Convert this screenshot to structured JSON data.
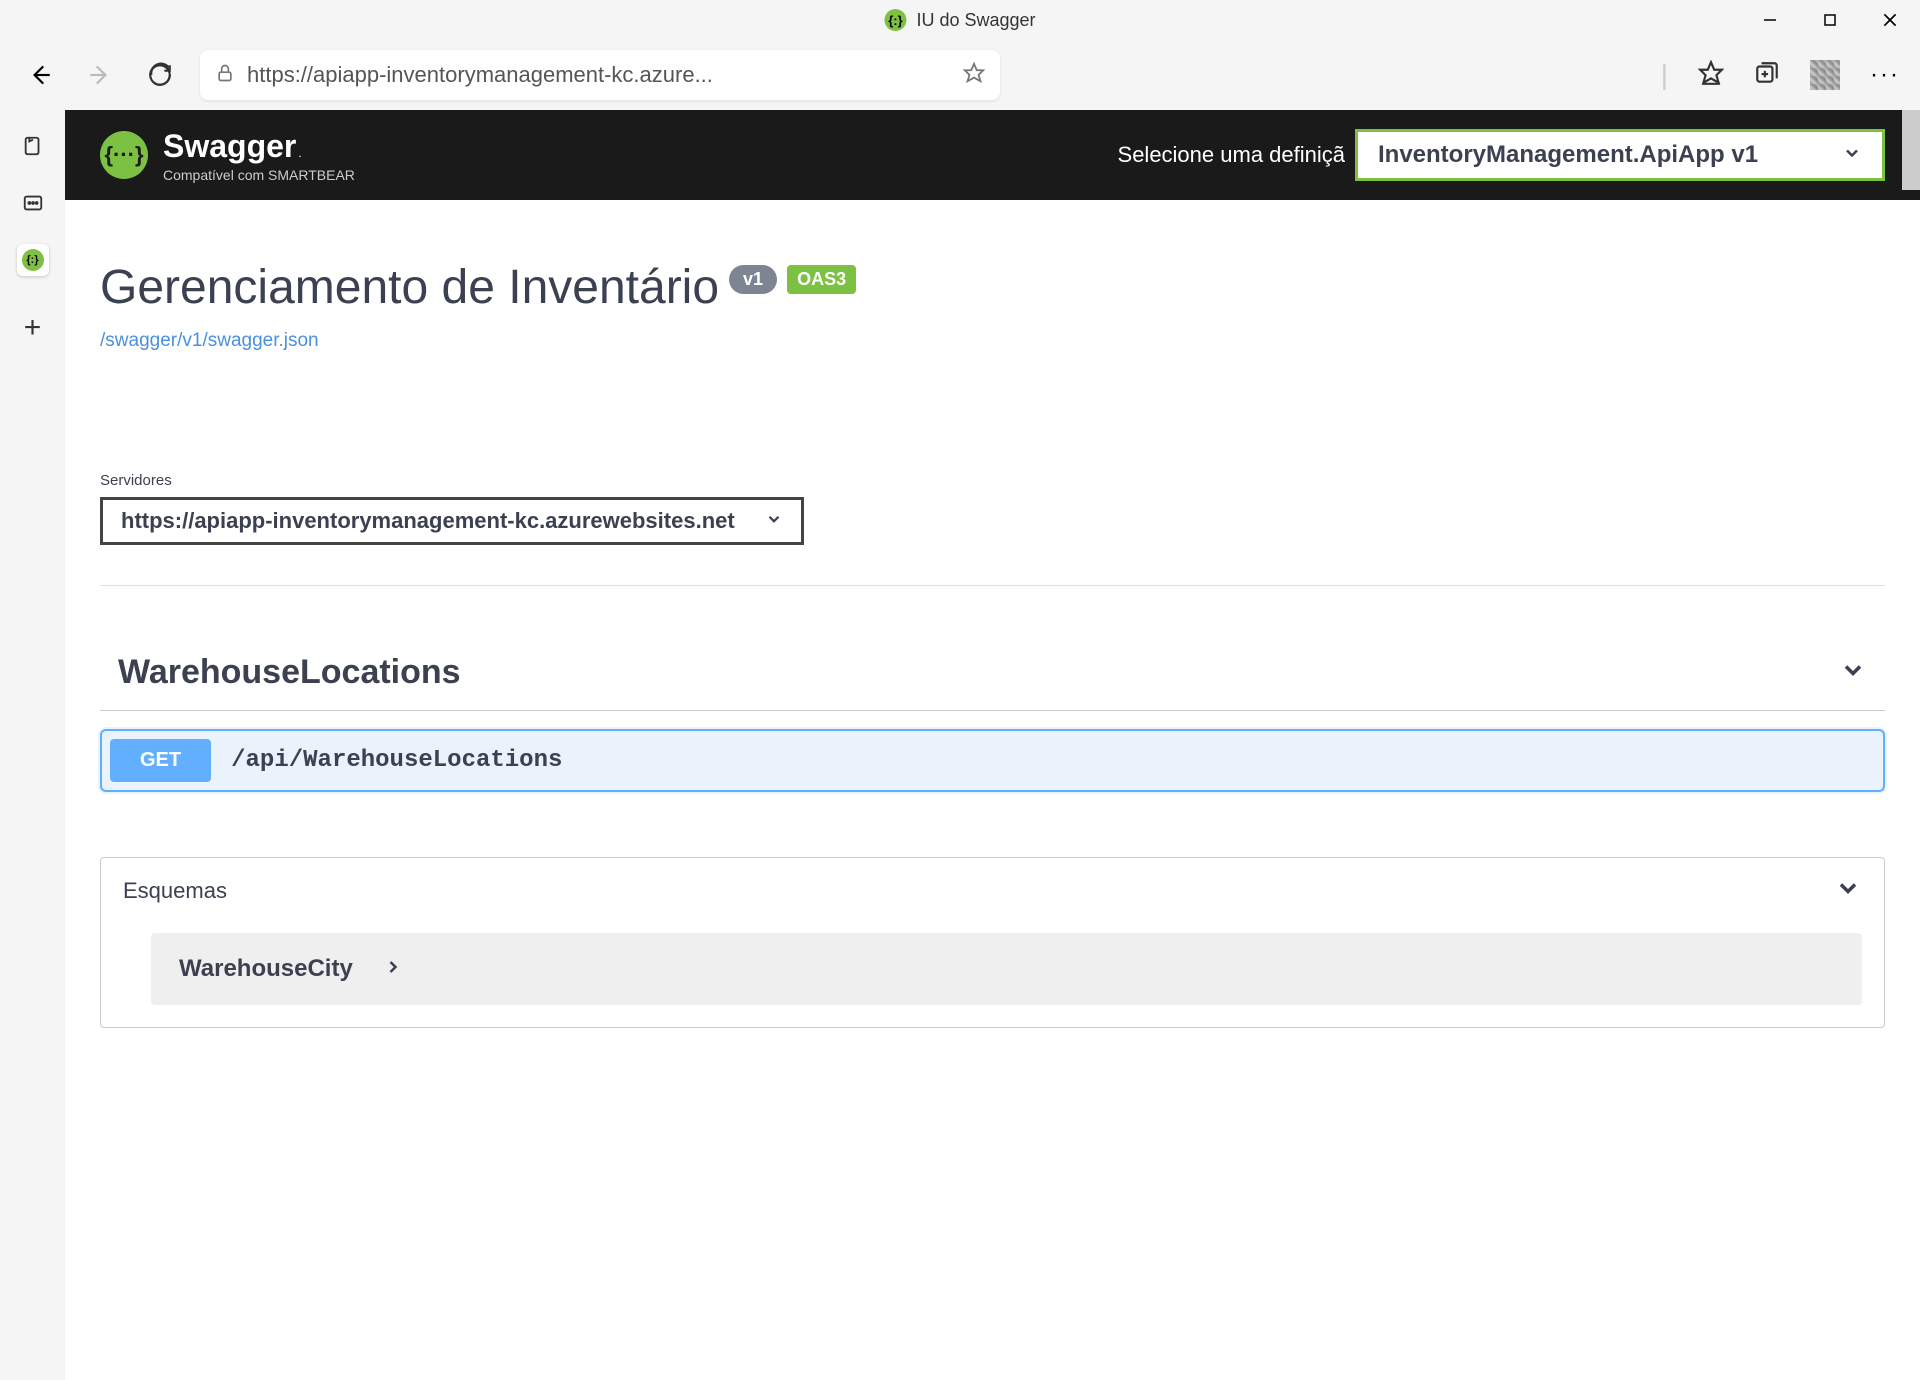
{
  "window": {
    "title": "IU do Swagger"
  },
  "addressbar": {
    "url": "https://apiapp-inventorymanagement-kc.azure..."
  },
  "swagger": {
    "brand": "Swagger",
    "tm": ".",
    "subtitle": "Compatível com SMARTBEAR",
    "select_label": "Selecione uma definiçã",
    "definition": "InventoryManagement.ApiApp v1",
    "api_title": "Gerenciamento de Inventário",
    "version_badge": "v1",
    "oas_badge": "OAS3",
    "json_link": "/swagger/v1/swagger.json",
    "servers_label": "Servidores",
    "server_url": "https://apiapp-inventorymanagement-kc.azurewebsites.net"
  },
  "endpoints": {
    "section_name": "WarehouseLocations",
    "item": {
      "method": "GET",
      "path": "/api/WarehouseLocations"
    }
  },
  "schemas": {
    "title": "Esquemas",
    "item_name": "WarehouseCity"
  }
}
